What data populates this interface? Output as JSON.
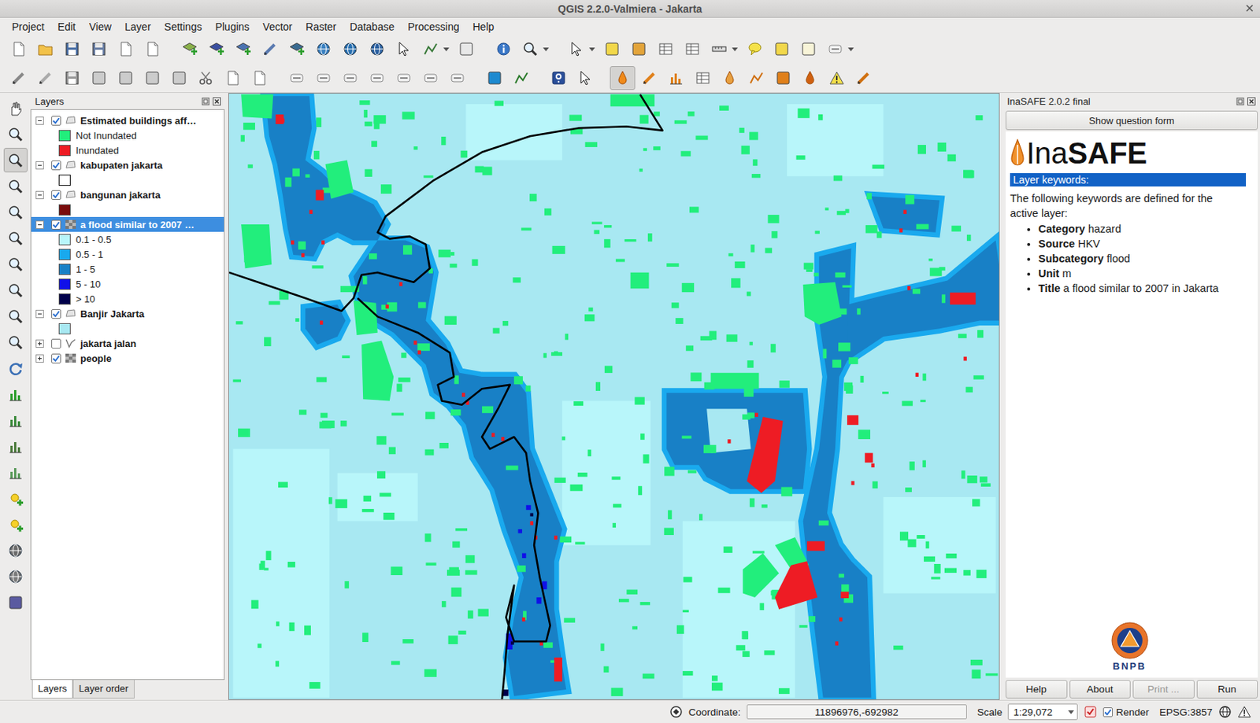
{
  "window": {
    "title": "QGIS 2.2.0-Valmiera - Jakarta"
  },
  "menu": [
    "Project",
    "Edit",
    "View",
    "Layer",
    "Settings",
    "Plugins",
    "Vector",
    "Raster",
    "Database",
    "Processing",
    "Help"
  ],
  "tools": {
    "zoom_in_active": true
  },
  "layers_panel": {
    "title": "Layers",
    "items": [
      {
        "name": "Estimated buildings aff…",
        "kind": "vector",
        "checked": true,
        "expanded": true,
        "selected": false,
        "legend": [
          {
            "label": "Not Inundated",
            "color": "#22ee7c"
          },
          {
            "label": "Inundated",
            "color": "#ee1c24"
          }
        ]
      },
      {
        "name": "kabupaten jakarta",
        "kind": "vector",
        "checked": true,
        "expanded": true,
        "selected": false,
        "legend": [
          {
            "color": "#ffffff"
          }
        ]
      },
      {
        "name": "bangunan jakarta",
        "kind": "vector",
        "checked": true,
        "expanded": true,
        "selected": false,
        "legend": [
          {
            "color": "#7a0c0c"
          }
        ]
      },
      {
        "name": "a flood similar to 2007 …",
        "kind": "raster",
        "checked": true,
        "expanded": true,
        "selected": true,
        "legend": [
          {
            "label": "0.1 - 0.5",
            "color": "#b8f6fa"
          },
          {
            "label": "0.5 - 1",
            "color": "#19a9ee"
          },
          {
            "label": "1 - 5",
            "color": "#1880c6"
          },
          {
            "label": "5 - 10",
            "color": "#1010e8"
          },
          {
            "label": "> 10",
            "color": "#00004a"
          }
        ]
      },
      {
        "name": "Banjir Jakarta",
        "kind": "vector",
        "checked": true,
        "expanded": true,
        "selected": false,
        "legend": [
          {
            "color": "#a8e8f2"
          }
        ]
      },
      {
        "name": "jakarta jalan",
        "kind": "line",
        "checked": false,
        "expanded": false,
        "selected": false,
        "legend": []
      },
      {
        "name": "people",
        "kind": "raster",
        "checked": true,
        "expanded": false,
        "selected": false,
        "legend": []
      }
    ],
    "tabs": [
      {
        "label": "Layers",
        "selected": true
      },
      {
        "label": "Layer order",
        "selected": false
      }
    ]
  },
  "inasafe": {
    "title": "InaSAFE 2.0.2 final",
    "toggle_pressed": true,
    "question_button": "Show question form",
    "logo": {
      "light": "Ina",
      "bold": "SAFE"
    },
    "heading": "Layer keywords:",
    "intro": "The following keywords are defined for the active layer:",
    "keywords": [
      {
        "key": "Category",
        "value": "hazard"
      },
      {
        "key": "Source",
        "value": "HKV"
      },
      {
        "key": "Subcategory",
        "value": "flood"
      },
      {
        "key": "Unit",
        "value": "m"
      },
      {
        "key": "Title",
        "value": "a flood similar to 2007 in Jakarta"
      }
    ],
    "agency": "BNPB",
    "buttons": [
      {
        "label": "Help",
        "disabled": false
      },
      {
        "label": "About",
        "disabled": false
      },
      {
        "label": "Print ...",
        "disabled": true
      },
      {
        "label": "Run",
        "disabled": false
      }
    ]
  },
  "status_bar": {
    "coordinate_label": "Coordinate:",
    "coordinate": "11896976,-692982",
    "scale_label": "Scale",
    "scale": "1:29,072",
    "render": {
      "label": "Render",
      "checked": true
    },
    "crs": "EPSG:3857"
  }
}
